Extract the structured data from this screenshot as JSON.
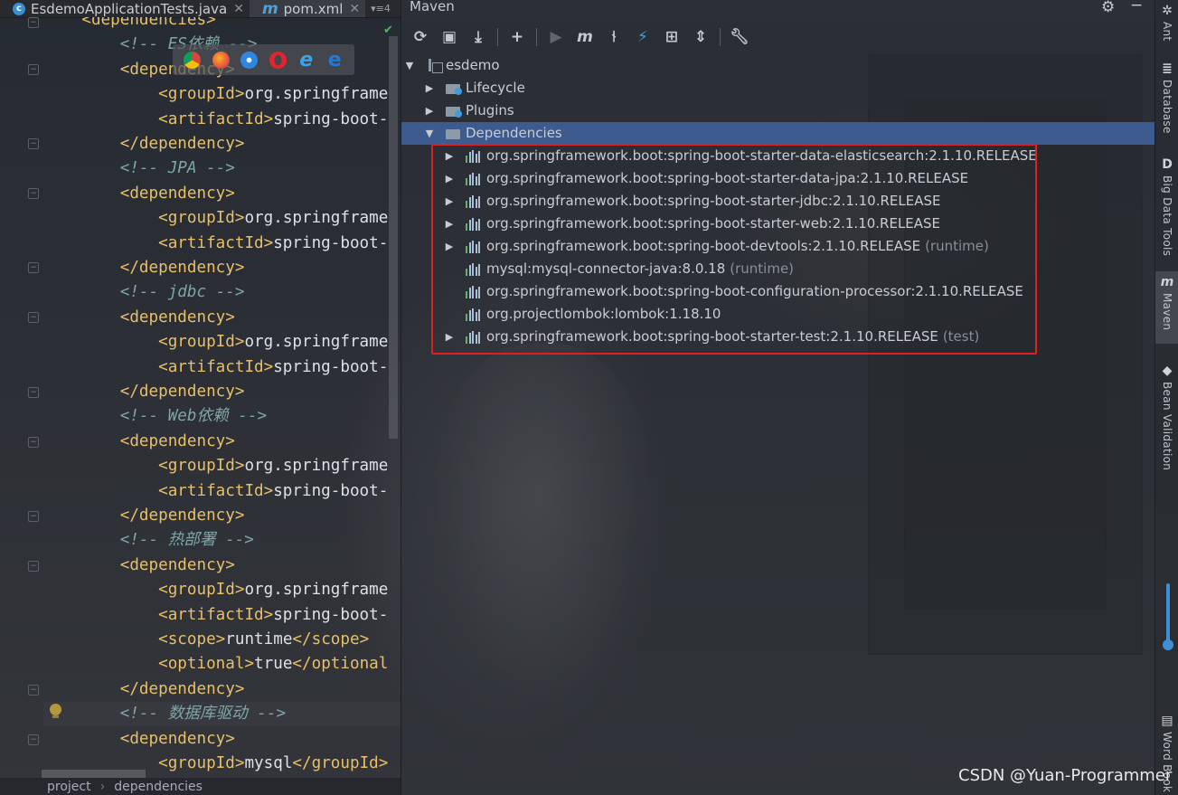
{
  "editor": {
    "tabs": [
      {
        "label": "EsdemoApplicationTests.java",
        "icon": "java-class-icon",
        "active": false
      },
      {
        "label": "pom.xml",
        "icon": "maven-m-icon",
        "active": true
      }
    ],
    "tab_overflow": "▾≡4",
    "lines": [
      [
        {
          "c": "tag",
          "t": "    <dependencies>"
        }
      ],
      [
        {
          "c": "com",
          "t": "        <!-- ES依赖 -->"
        }
      ],
      [
        {
          "c": "tag",
          "t": "        <dependency>"
        }
      ],
      [
        {
          "c": "tag",
          "t": "            <groupId>"
        },
        {
          "c": "txt",
          "t": "org.springframe"
        }
      ],
      [
        {
          "c": "tag",
          "t": "            <artifactId>"
        },
        {
          "c": "txt",
          "t": "spring-boot-"
        }
      ],
      [
        {
          "c": "tag",
          "t": "        </dependency>"
        }
      ],
      [
        {
          "c": "com",
          "t": "        <!-- JPA -->"
        }
      ],
      [
        {
          "c": "tag",
          "t": "        <dependency>"
        }
      ],
      [
        {
          "c": "tag",
          "t": "            <groupId>"
        },
        {
          "c": "txt",
          "t": "org.springframe"
        }
      ],
      [
        {
          "c": "tag",
          "t": "            <artifactId>"
        },
        {
          "c": "txt",
          "t": "spring-boot-"
        }
      ],
      [
        {
          "c": "tag",
          "t": "        </dependency>"
        }
      ],
      [
        {
          "c": "com",
          "t": "        <!-- jdbc -->"
        }
      ],
      [
        {
          "c": "tag",
          "t": "        <dependency>"
        }
      ],
      [
        {
          "c": "tag",
          "t": "            <groupId>"
        },
        {
          "c": "txt",
          "t": "org.springframe"
        }
      ],
      [
        {
          "c": "tag",
          "t": "            <artifactId>"
        },
        {
          "c": "txt",
          "t": "spring-boot-"
        }
      ],
      [
        {
          "c": "tag",
          "t": "        </dependency>"
        }
      ],
      [
        {
          "c": "com",
          "t": "        <!-- Web依赖 -->"
        }
      ],
      [
        {
          "c": "tag",
          "t": "        <dependency>"
        }
      ],
      [
        {
          "c": "tag",
          "t": "            <groupId>"
        },
        {
          "c": "txt",
          "t": "org.springframe"
        }
      ],
      [
        {
          "c": "tag",
          "t": "            <artifactId>"
        },
        {
          "c": "txt",
          "t": "spring-boot-"
        }
      ],
      [
        {
          "c": "tag",
          "t": "        </dependency>"
        }
      ],
      [
        {
          "c": "com",
          "t": "        <!-- 热部署 -->"
        }
      ],
      [
        {
          "c": "tag",
          "t": "        <dependency>"
        }
      ],
      [
        {
          "c": "tag",
          "t": "            <groupId>"
        },
        {
          "c": "txt",
          "t": "org.springframe"
        }
      ],
      [
        {
          "c": "tag",
          "t": "            <artifactId>"
        },
        {
          "c": "txt",
          "t": "spring-boot-"
        }
      ],
      [
        {
          "c": "tag",
          "t": "            <scope>"
        },
        {
          "c": "txt",
          "t": "runtime"
        },
        {
          "c": "tag",
          "t": "</scope>"
        }
      ],
      [
        {
          "c": "tag",
          "t": "            <optional>"
        },
        {
          "c": "txt",
          "t": "true"
        },
        {
          "c": "tag",
          "t": "</optional"
        }
      ],
      [
        {
          "c": "tag",
          "t": "        </dependency>"
        }
      ],
      [
        {
          "c": "com",
          "t": "        <!-- 数据库驱动 -->"
        }
      ],
      [
        {
          "c": "tag",
          "t": "        <dependency>"
        }
      ],
      [
        {
          "c": "tag",
          "t": "            <groupId>"
        },
        {
          "c": "txt",
          "t": "mysql"
        },
        {
          "c": "tag",
          "t": "</groupId>"
        }
      ]
    ],
    "browser_icons": [
      "chrome-icon",
      "firefox-icon",
      "safari-icon",
      "opera-icon",
      "ie-icon",
      "edge-icon"
    ],
    "breadcrumb": [
      "project",
      "dependencies"
    ]
  },
  "maven": {
    "title": "Maven",
    "toolbar": [
      "reload-icon",
      "reimport-folder-icon",
      "download-icon",
      "add-icon",
      "run-icon",
      "maven-goal-icon",
      "toggle-offline-icon",
      "skip-tests-icon",
      "show-dependencies-icon",
      "collapse-all-icon",
      "settings-wrench-icon"
    ],
    "project": "esdemo",
    "nodes": [
      "Lifecycle",
      "Plugins",
      "Dependencies"
    ],
    "dependencies": [
      {
        "name": "org.springframework.boot:spring-boot-starter-data-elasticsearch:2.1.10.RELEASE",
        "scope": "",
        "expandable": true
      },
      {
        "name": "org.springframework.boot:spring-boot-starter-data-jpa:2.1.10.RELEASE",
        "scope": "",
        "expandable": true
      },
      {
        "name": "org.springframework.boot:spring-boot-starter-jdbc:2.1.10.RELEASE",
        "scope": "",
        "expandable": true
      },
      {
        "name": "org.springframework.boot:spring-boot-starter-web:2.1.10.RELEASE",
        "scope": "",
        "expandable": true
      },
      {
        "name": "org.springframework.boot:spring-boot-devtools:2.1.10.RELEASE",
        "scope": "(runtime)",
        "expandable": true
      },
      {
        "name": "mysql:mysql-connector-java:8.0.18",
        "scope": "(runtime)",
        "expandable": false
      },
      {
        "name": "org.springframework.boot:spring-boot-configuration-processor:2.1.10.RELEASE",
        "scope": "",
        "expandable": false
      },
      {
        "name": "org.projectlombok:lombok:1.18.10",
        "scope": "",
        "expandable": false
      },
      {
        "name": "org.springframework.boot:spring-boot-starter-test:2.1.10.RELEASE",
        "scope": "(test)",
        "expandable": true
      }
    ]
  },
  "sidebar": {
    "items": [
      {
        "label": "Ant",
        "icon": "ant-icon"
      },
      {
        "label": "Database",
        "icon": "database-icon"
      },
      {
        "label": "Big Data Tools",
        "icon": "big-data-tools-icon"
      },
      {
        "label": "Maven",
        "icon": "maven-m-icon"
      },
      {
        "label": "Bean Validation",
        "icon": "bean-validation-icon"
      },
      {
        "label": "Word Book",
        "icon": "word-book-icon"
      }
    ]
  },
  "watermark": "CSDN @Yuan-Programmer",
  "colors": {
    "tag": "#e8bf6a",
    "comment": "#7fa7a2",
    "selection": "#3d5b8f",
    "highlight_box": "#e02020"
  }
}
